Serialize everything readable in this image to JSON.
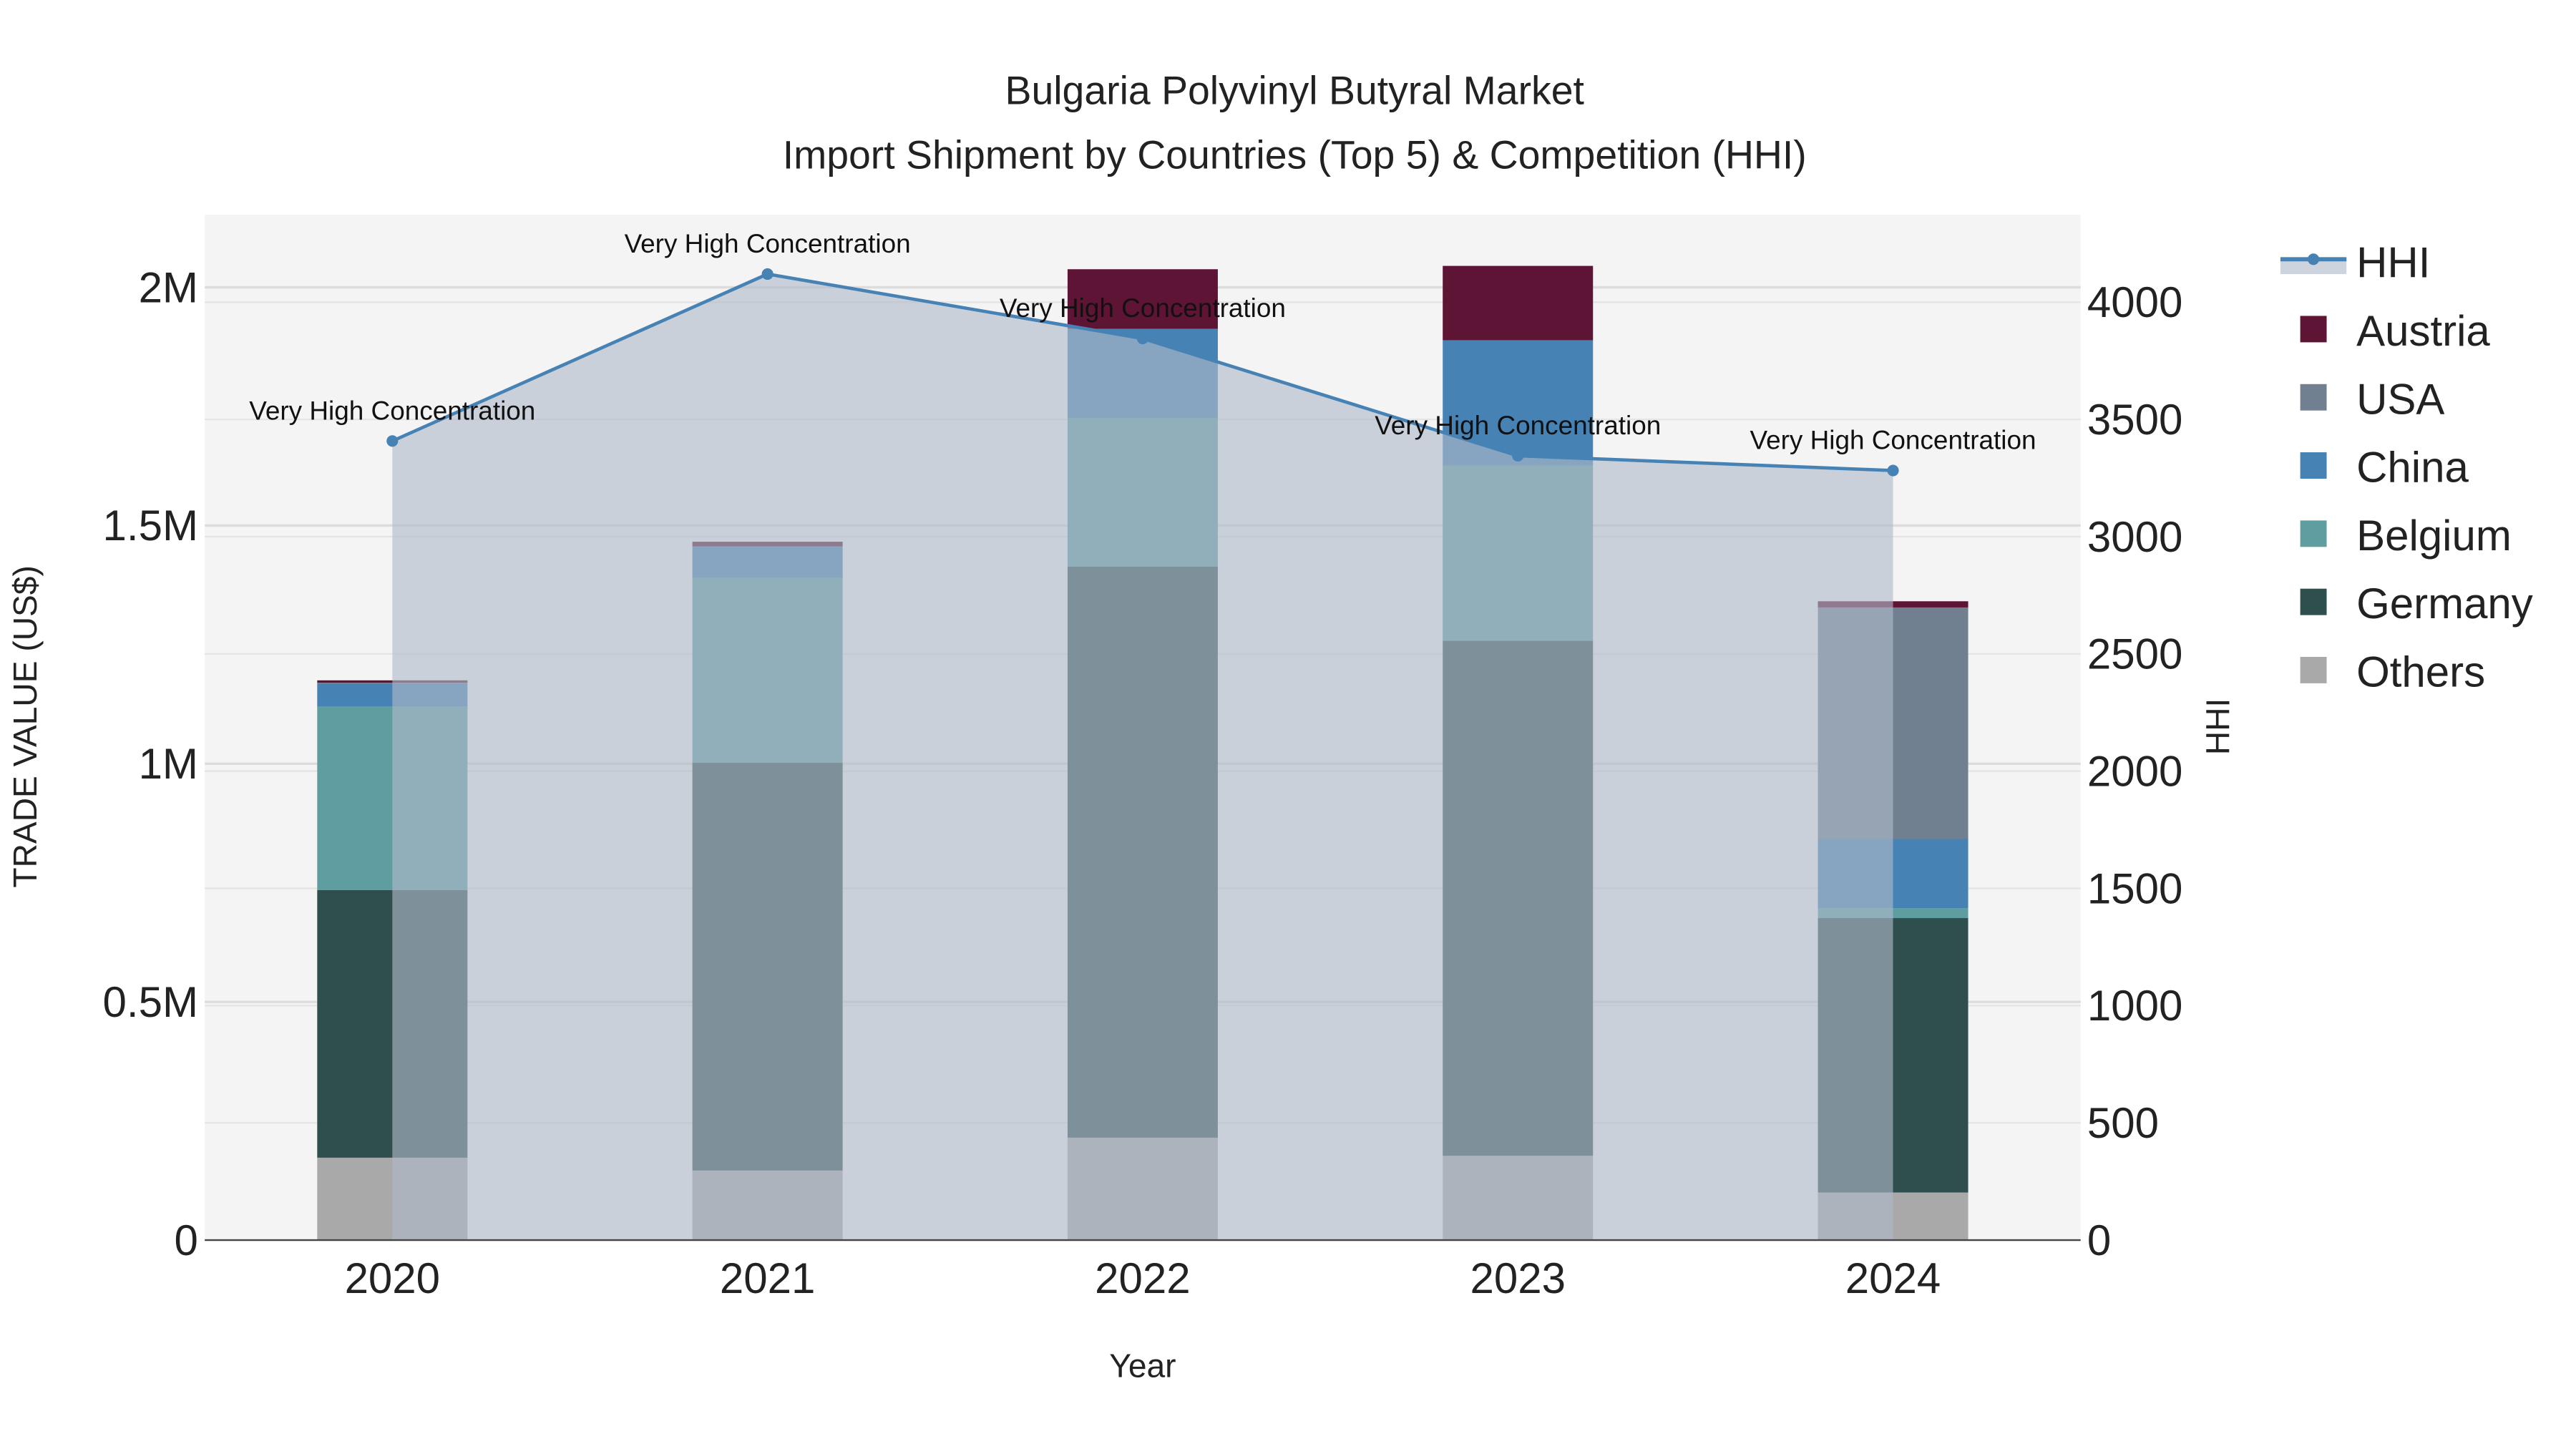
{
  "chart_data": {
    "type": "bar",
    "title": "Bulgaria Polyvinyl Butyral Market",
    "subtitle": "Import Shipment by Countries (Top 5) & Competition (HHI)",
    "xlabel": "Year",
    "ylabel": "TRADE VALUE (US$)",
    "y2label": "HHI",
    "categories": [
      "2020",
      "2021",
      "2022",
      "2023",
      "2024"
    ],
    "ylim": [
      0,
      2150000
    ],
    "y2lim": [
      0,
      4370
    ],
    "yticks": [
      {
        "v": 0,
        "label": "0"
      },
      {
        "v": 500000,
        "label": "0.5M"
      },
      {
        "v": 1000000,
        "label": "1M"
      },
      {
        "v": 1500000,
        "label": "1.5M"
      },
      {
        "v": 2000000,
        "label": "2M"
      }
    ],
    "y2ticks": [
      0,
      500,
      1000,
      1500,
      2000,
      2500,
      3000,
      3500,
      4000
    ],
    "stacked": true,
    "series": [
      {
        "name": "Others",
        "color": "#a9a9a9",
        "values": [
          173000,
          146000,
          215000,
          177000,
          100000
        ]
      },
      {
        "name": "Germany",
        "color": "#2f4f4f",
        "values": [
          562000,
          856000,
          1199000,
          1081000,
          576000
        ]
      },
      {
        "name": "Belgium",
        "color": "#5f9ea0",
        "values": [
          385000,
          388000,
          312000,
          368000,
          21000
        ]
      },
      {
        "name": "China",
        "color": "#4682b4",
        "values": [
          48000,
          66000,
          187000,
          263000,
          145000
        ]
      },
      {
        "name": "USA",
        "color": "#708090",
        "values": [
          2000,
          0,
          0,
          0,
          486000
        ]
      },
      {
        "name": "Austria",
        "color": "#5e1434",
        "values": [
          5000,
          10000,
          125000,
          156000,
          13000
        ]
      }
    ],
    "hhi": {
      "name": "HHI",
      "color": "#4682b4",
      "values": [
        3408,
        4120,
        3845,
        3345,
        3282
      ],
      "annotations": [
        "Very High Concentration",
        "Very High Concentration",
        "Very High Concentration",
        "Very High Concentration",
        "Very High Concentration"
      ]
    },
    "legend": [
      "HHI",
      "Austria",
      "USA",
      "China",
      "Belgium",
      "Germany",
      "Others"
    ],
    "legend_position": "right",
    "grid": true
  }
}
